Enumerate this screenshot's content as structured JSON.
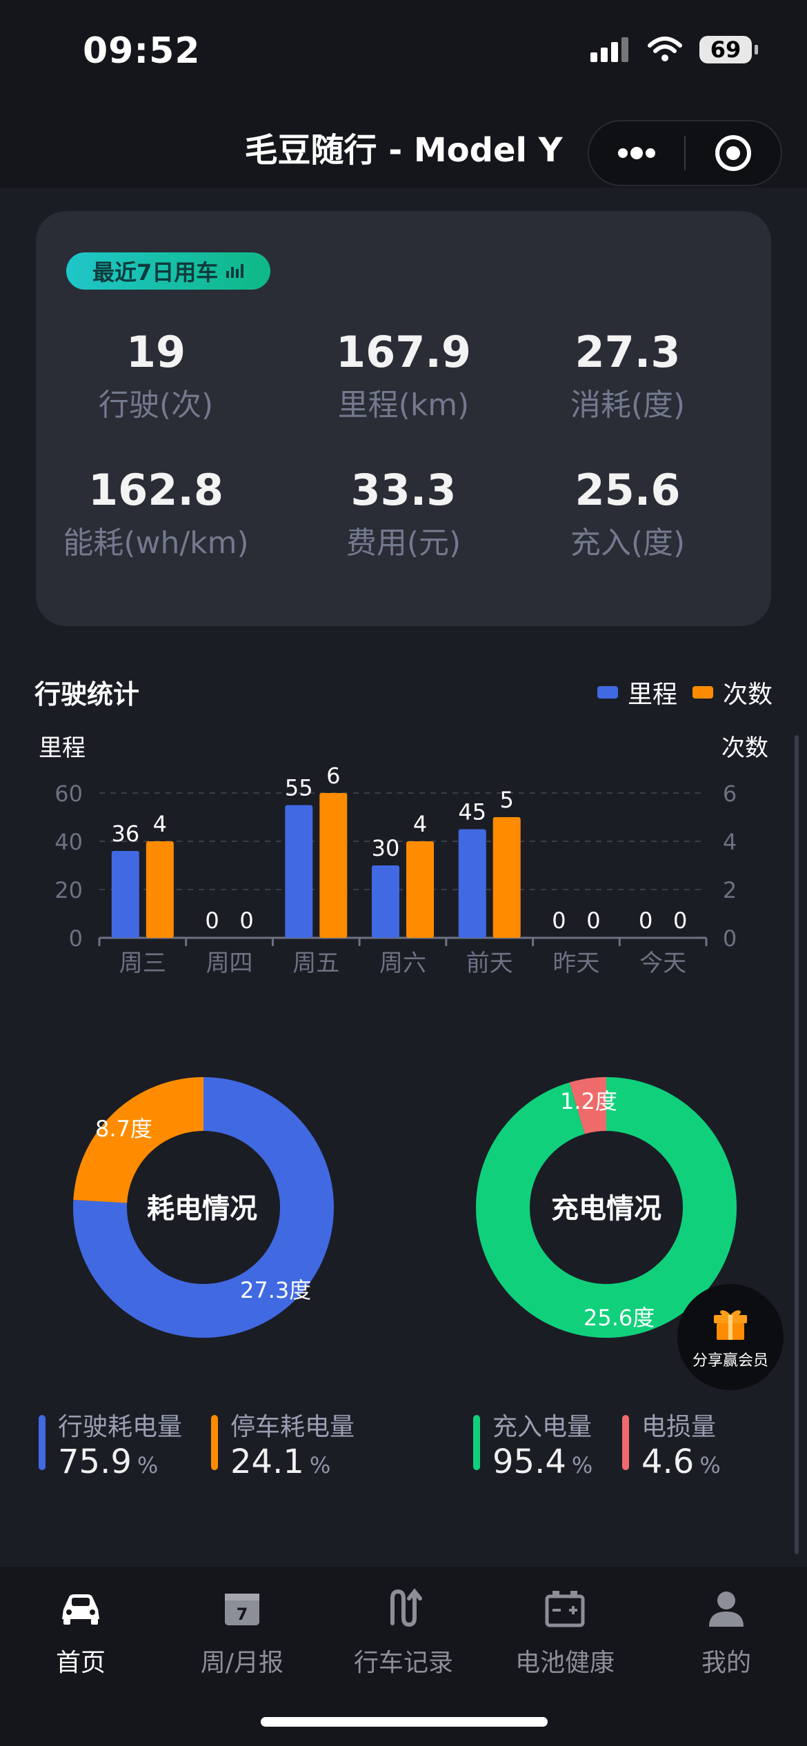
{
  "status": {
    "time": "09:52",
    "battery": "69"
  },
  "nav": {
    "title": "毛豆随行 - Model Y"
  },
  "summary": {
    "badge": "最近7日用车",
    "stats": [
      {
        "value": "19",
        "label": "行驶(次)"
      },
      {
        "value": "167.9",
        "label": "里程(km)"
      },
      {
        "value": "27.3",
        "label": "消耗(度)"
      },
      {
        "value": "162.8",
        "label": "能耗(wh/km)"
      },
      {
        "value": "33.3",
        "label": "费用(元)"
      },
      {
        "value": "25.6",
        "label": "充入(度)"
      }
    ]
  },
  "drive_stats": {
    "title": "行驶统计",
    "legend_mileage": "里程",
    "legend_count": "次数"
  },
  "chart_data": {
    "type": "bar",
    "categories": [
      "周三",
      "周四",
      "周五",
      "周六",
      "前天",
      "昨天",
      "今天"
    ],
    "series": [
      {
        "name": "里程",
        "values": [
          36,
          0,
          55,
          30,
          45,
          0,
          0
        ],
        "color": "#4169e1"
      },
      {
        "name": "次数",
        "values": [
          4,
          0,
          6,
          4,
          5,
          0,
          0
        ],
        "color": "#ff8c00"
      }
    ],
    "ylabel": "里程",
    "y2label": "次数",
    "ylim": [
      0,
      60
    ],
    "y2lim": [
      0,
      6
    ],
    "yticks": [
      "0",
      "20",
      "40",
      "60"
    ],
    "y2ticks": [
      "0",
      "2",
      "4",
      "6"
    ],
    "grid": true,
    "legend": "top-right"
  },
  "donuts": {
    "consumption": {
      "label": "耗电情况",
      "driving_value": "27.3度",
      "parking_value": "8.7度",
      "driving_fraction": 0.759,
      "parking_fraction": 0.241
    },
    "charging": {
      "label": "充电情况",
      "charged_value": "25.6度",
      "loss_value": "1.2度",
      "charged_fraction": 0.954,
      "loss_fraction": 0.046
    }
  },
  "percentages": [
    {
      "name": "行驶耗电量",
      "value": "75.9",
      "unit": "%",
      "color": "#4169e1"
    },
    {
      "name": "停车耗电量",
      "value": "24.1",
      "unit": "%",
      "color": "#ff8c00"
    },
    {
      "name": "充入电量",
      "value": "95.4",
      "unit": "%",
      "color": "#10d07c"
    },
    {
      "name": "电损量",
      "value": "4.6",
      "unit": "%",
      "color": "#ef6b6b"
    }
  ],
  "gift": {
    "label": "分享赢会员"
  },
  "tabs": [
    {
      "label": "首页",
      "icon": "car-icon"
    },
    {
      "label": "周/月报",
      "icon": "calendar-icon"
    },
    {
      "label": "行车记录",
      "icon": "route-icon"
    },
    {
      "label": "电池健康",
      "icon": "battery-icon"
    },
    {
      "label": "我的",
      "icon": "user-icon"
    }
  ],
  "colors": {
    "blue": "#4169e1",
    "orange": "#ff8c00",
    "green": "#10d07c",
    "red": "#ef6b6b"
  }
}
